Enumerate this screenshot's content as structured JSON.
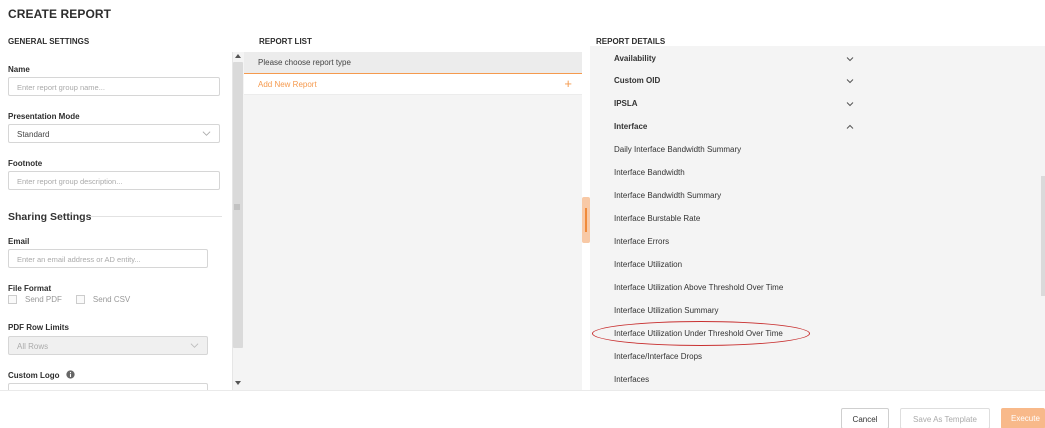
{
  "page_title": "CREATE REPORT",
  "sections": {
    "general": "GENERAL SETTINGS",
    "report_list": "REPORT LIST",
    "report_details": "REPORT DETAILS"
  },
  "general": {
    "name_label": "Name",
    "name_placeholder": "Enter report group name...",
    "mode_label": "Presentation Mode",
    "mode_value": "Standard",
    "footnote_label": "Footnote",
    "footnote_placeholder": "Enter report group description...",
    "sharing_title": "Sharing Settings",
    "email_label": "Email",
    "email_placeholder": "Enter an email address or AD entity...",
    "file_format_label": "File Format",
    "send_pdf": "Send PDF",
    "send_csv": "Send CSV",
    "pdf_limits_label": "PDF Row Limits",
    "pdf_limits_value": "All Rows",
    "custom_logo_label": "Custom Logo"
  },
  "report_list": {
    "choose": "Please choose report type",
    "add_new": "Add New Report",
    "add_icon": "plus-icon"
  },
  "report_details": {
    "categories": [
      {
        "label": "Availability",
        "expanded": false
      },
      {
        "label": "Custom OID",
        "expanded": false
      },
      {
        "label": "IPSLA",
        "expanded": false
      },
      {
        "label": "Interface",
        "expanded": true
      }
    ],
    "interface_reports": [
      "Daily Interface Bandwidth Summary",
      "Interface Bandwidth",
      "Interface Bandwidth Summary",
      "Interface Burstable Rate",
      "Interface Errors",
      "Interface Utilization",
      "Interface Utilization Above Threshold Over Time",
      "Interface Utilization Summary",
      "Interface Utilization Under Threshold Over Time",
      "Interface/Interface Drops",
      "Interfaces"
    ],
    "highlighted": "Interface Utilization Under Threshold Over Time"
  },
  "footer": {
    "cancel": "Cancel",
    "save_template": "Save As Template",
    "execute": "Execute"
  },
  "colors": {
    "accent": "#f59a4e",
    "highlight": "#c83030"
  }
}
